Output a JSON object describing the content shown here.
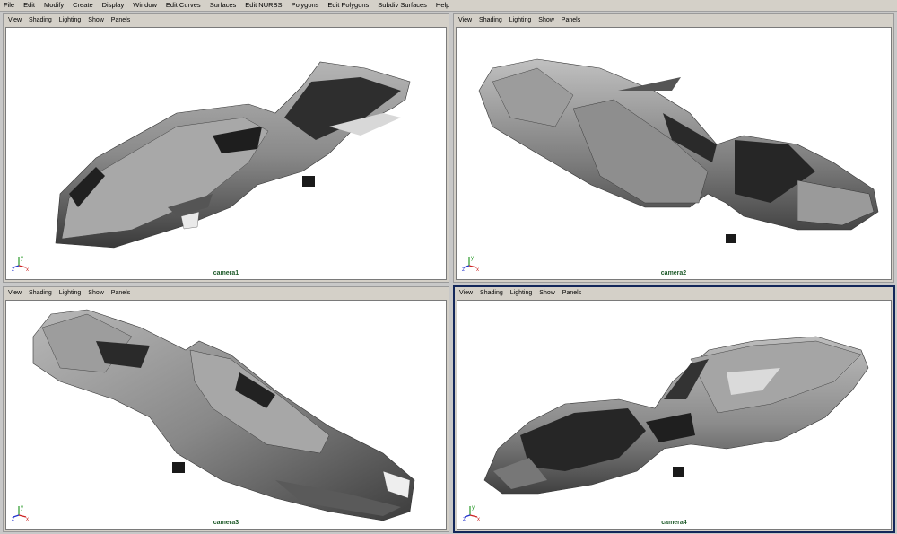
{
  "menubar": {
    "items": [
      "File",
      "Edit",
      "Modify",
      "Create",
      "Display",
      "Window",
      "Edit Curves",
      "Surfaces",
      "Edit NURBS",
      "Polygons",
      "Edit Polygons",
      "Subdiv Surfaces",
      "Help"
    ]
  },
  "panel_menu": {
    "view": "View",
    "shading": "Shading",
    "lighting": "Lighting",
    "show": "Show",
    "panels": "Panels"
  },
  "viewports": [
    {
      "camera": "camera1",
      "active": false
    },
    {
      "camera": "camera2",
      "active": false
    },
    {
      "camera": "camera3",
      "active": false
    },
    {
      "camera": "camera4",
      "active": true
    }
  ],
  "axis": {
    "x": "x",
    "y": "y",
    "z": "z"
  },
  "colors": {
    "menubar_bg": "#d4d0c8",
    "viewport_bg": "#ffffff",
    "camera_label": "#1e5a2a",
    "active_border": "#13275a",
    "model_gray": "#8a8a8a"
  }
}
